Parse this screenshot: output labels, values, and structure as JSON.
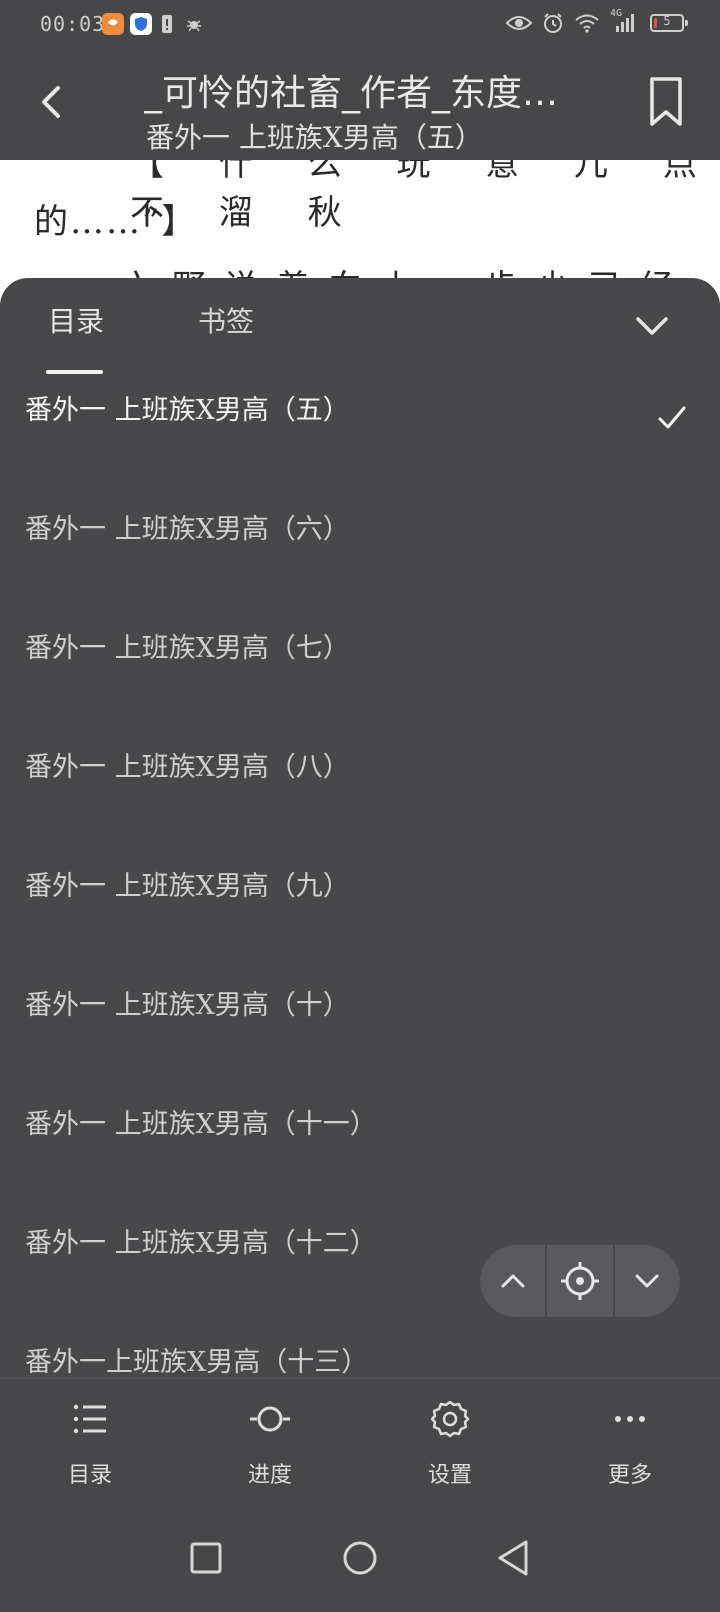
{
  "status_bar": {
    "time": "00:03",
    "network_badge": "4G",
    "battery_level": "5",
    "icons": [
      "app-notification-icon",
      "shield-app-icon",
      "sim-warning-icon",
      "bug-icon",
      "eye-icon",
      "alarm-icon",
      "wifi-icon",
      "signal-icon",
      "battery-icon"
    ],
    "battery_color": "#e05050"
  },
  "topbar": {
    "book_title": "_可怜的社畜_作者_东度…",
    "chapter_title": "番外一 上班族X男高（五）"
  },
  "reading": {
    "line1": "【 什 么 玩 意 儿 点 不 溜 秋",
    "line2": "的……”】",
    "line3": "六野说着向上一步少已经来了"
  },
  "panel": {
    "tabs": [
      {
        "label": "目录",
        "active": true
      },
      {
        "label": "书签",
        "active": false
      }
    ],
    "items": [
      {
        "label": "番外一 上班族X男高（五）",
        "current": true
      },
      {
        "label": "番外一 上班族X男高（六）",
        "current": false
      },
      {
        "label": "番外一 上班族X男高（七）",
        "current": false
      },
      {
        "label": "番外一 上班族X男高（八）",
        "current": false
      },
      {
        "label": "番外一 上班族X男高（九）",
        "current": false
      },
      {
        "label": "番外一 上班族X男高（十）",
        "current": false
      },
      {
        "label": "番外一 上班族X男高（十一）",
        "current": false
      },
      {
        "label": "番外一 上班族X男高（十二）",
        "current": false
      },
      {
        "label": "番外一上班族X男高（十三）",
        "current": false
      }
    ]
  },
  "bottom_toolbar": {
    "items": [
      {
        "label": "目录",
        "icon": "list-icon"
      },
      {
        "label": "进度",
        "icon": "progress-icon"
      },
      {
        "label": "设置",
        "icon": "gear-icon"
      },
      {
        "label": "更多",
        "icon": "more-icon"
      }
    ]
  },
  "colors": {
    "panel_bg": "#48484b",
    "bar_bg": "#47474a",
    "text": "#e6e6e6"
  }
}
